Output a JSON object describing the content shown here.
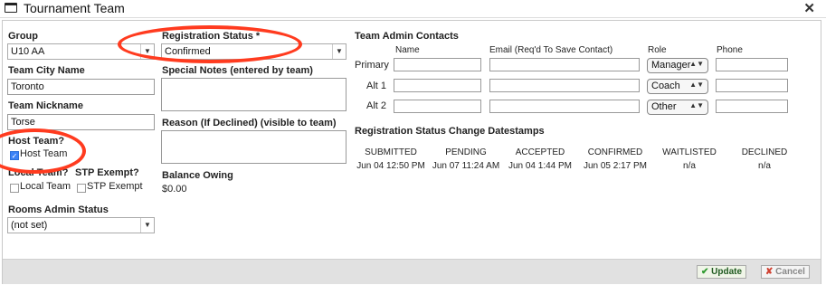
{
  "window": {
    "title": "Tournament Team"
  },
  "left": {
    "group_label": "Group",
    "group_value": "U10 AA",
    "city_label": "Team City Name",
    "city_value": "Toronto",
    "nickname_label": "Team Nickname",
    "nickname_value": "Torse",
    "host_label": "Host Team?",
    "host_checkbox_label": "Host Team",
    "local_label": "Local Team?",
    "local_checkbox_label": "Local Team",
    "stp_label": "STP Exempt?",
    "stp_checkbox_label": "STP Exempt",
    "rooms_label": "Rooms Admin Status",
    "rooms_value": "(not set)"
  },
  "middle": {
    "reg_status_label": "Registration Status *",
    "reg_status_value": "Confirmed",
    "special_notes_label": "Special Notes (entered by team)",
    "reason_label": "Reason (If Declined) (visible to team)",
    "balance_label": "Balance Owing",
    "balance_value": "$0.00"
  },
  "contacts": {
    "title": "Team Admin Contacts",
    "headers": {
      "name": "Name",
      "email": "Email (Req'd To Save Contact)",
      "role": "Role",
      "phone": "Phone"
    },
    "rows": [
      {
        "label": "Primary",
        "role": "Manager"
      },
      {
        "label": "Alt 1",
        "role": "Coach"
      },
      {
        "label": "Alt 2",
        "role": "Other"
      }
    ]
  },
  "datestamps": {
    "title": "Registration Status Change Datestamps",
    "columns": [
      {
        "header": "SUBMITTED",
        "value": "Jun 04 12:50 PM"
      },
      {
        "header": "PENDING",
        "value": "Jun 07 11:24 AM"
      },
      {
        "header": "ACCEPTED",
        "value": "Jun 04 1:44 PM"
      },
      {
        "header": "CONFIRMED",
        "value": "Jun 05 2:17 PM"
      },
      {
        "header": "WAITLISTED",
        "value": "n/a"
      },
      {
        "header": "DECLINED",
        "value": "n/a"
      }
    ]
  },
  "footer": {
    "update_label": "Update",
    "cancel_label": "Cancel"
  },
  "colors": {
    "annotation_circle": "#ff3b1f",
    "footer_bg": "#e1e1e1"
  }
}
